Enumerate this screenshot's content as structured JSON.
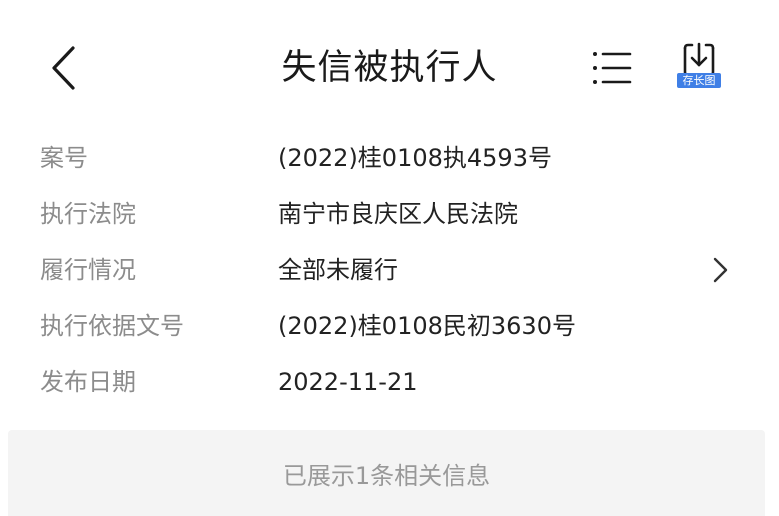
{
  "header": {
    "title": "失信被执行人",
    "back_icon": "chevron-left-icon",
    "menu_icon": "list-menu-icon",
    "save_icon": "download-icon",
    "save_label": "存长图"
  },
  "details": [
    {
      "label": "案号",
      "value": "(2022)桂0108执4593号"
    },
    {
      "label": "执行法院",
      "value": "南宁市良庆区人民法院"
    },
    {
      "label": "履行情况",
      "value": "全部未履行"
    },
    {
      "label": "执行依据文号",
      "value": "(2022)桂0108民初3630号"
    },
    {
      "label": "发布日期",
      "value": "2022-11-21"
    }
  ],
  "footer": {
    "text": "已展示1条相关信息"
  },
  "colors": {
    "accent": "#3f7fe6",
    "label": "#8c8c8c",
    "value": "#222222",
    "footer_bg": "#f4f4f4"
  }
}
